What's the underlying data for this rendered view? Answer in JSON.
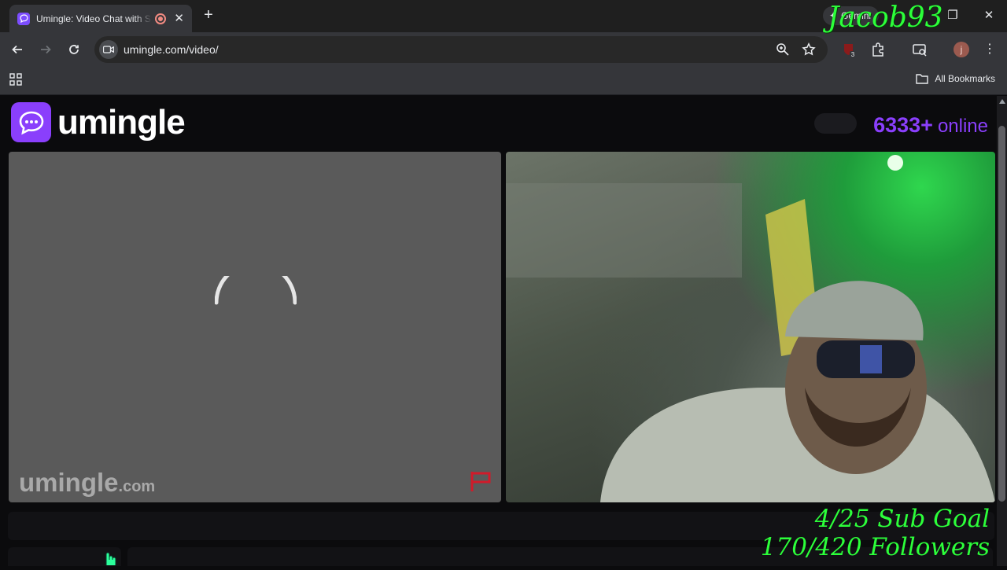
{
  "browser": {
    "tab_title": "Umingle: Video Chat with Strangers",
    "gemini_label": "Gemini",
    "url": "umingle.com/video/",
    "extension_badge": "3",
    "profile_initial": "j",
    "all_bookmarks": "All Bookmarks"
  },
  "site": {
    "logo_text": "umingle",
    "online_count": "6333+",
    "online_label": "online",
    "watermark_main": "umingle",
    "watermark_suffix": ".com",
    "brand_color": "#8a3ffc"
  },
  "overlay": {
    "streamer_name": "Jacob93",
    "sub_goal": "4/25 Sub Goal",
    "followers": "170/420 Followers",
    "text_color": "#2cff3a"
  }
}
